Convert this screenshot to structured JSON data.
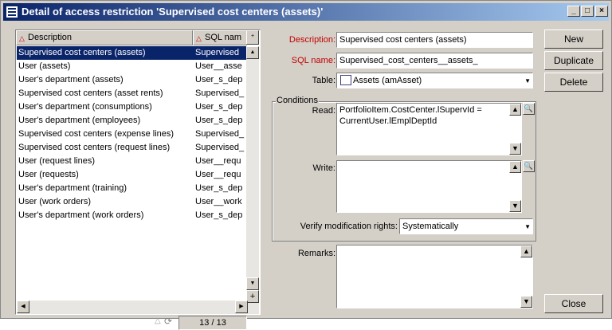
{
  "window": {
    "title": "Detail of access restriction 'Supervised cost centers (assets)'"
  },
  "list": {
    "columns": [
      "Description",
      "SQL nam"
    ],
    "rows": [
      [
        "Supervised cost centers (assets)",
        "Supervised"
      ],
      [
        "User (assets)",
        "User__asse"
      ],
      [
        "User's department (assets)",
        "User_s_dep"
      ],
      [
        "Supervised cost centers (asset rents)",
        "Supervised_"
      ],
      [
        "User's department (consumptions)",
        "User_s_dep"
      ],
      [
        "User's department (employees)",
        "User_s_dep"
      ],
      [
        "Supervised cost centers (expense lines)",
        "Supervised_"
      ],
      [
        "Supervised cost centers (request lines)",
        "Supervised_"
      ],
      [
        "User (request lines)",
        "User__requ"
      ],
      [
        "User (requests)",
        "User__requ"
      ],
      [
        "User's department (training)",
        "User_s_dep"
      ],
      [
        "User (work orders)",
        "User__work"
      ],
      [
        "User's department (work orders)",
        "User_s_dep"
      ]
    ],
    "count": "13 / 13"
  },
  "form": {
    "description_label": "Description:",
    "description_value": "Supervised cost centers (assets)",
    "sqlname_label": "SQL name:",
    "sqlname_value": "Supervised_cost_centers__assets_",
    "table_label": "Table:",
    "table_value": "Assets (amAsset)",
    "conditions_label": "Conditions",
    "read_label": "Read:",
    "read_line1": "PortfolioItem.CostCenter.lSupervId =",
    "read_line2": "CurrentUser.lEmplDeptId",
    "write_label": "Write:",
    "write_value": "",
    "verify_label": "Verify modification rights:",
    "verify_value": "Systematically",
    "remarks_label": "Remarks:",
    "remarks_value": ""
  },
  "buttons": {
    "new": "New",
    "duplicate": "Duplicate",
    "delete": "Delete",
    "close": "Close"
  },
  "colors": {
    "title_start": "#0a246a",
    "title_end": "#a6caf0",
    "selection": "#0a246a",
    "required_label": "#c00000"
  }
}
